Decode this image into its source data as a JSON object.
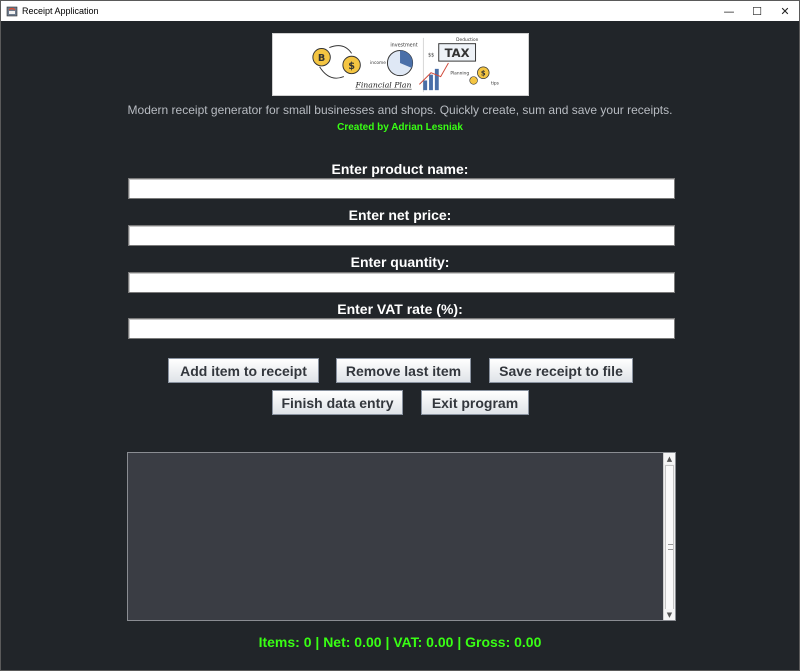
{
  "window": {
    "title": "Receipt Application",
    "controls": {
      "minimize": "—",
      "maximize": "☐",
      "close": "✕"
    }
  },
  "header": {
    "banner_icons": [
      "bitcoin-coin-icon",
      "dollar-coin-icon",
      "pie-chart-icon",
      "tax-board-icon",
      "bar-chart-icon"
    ],
    "banner_words": {
      "financial_plan": "Financial Plan",
      "investment": "investment",
      "income": "income",
      "tax": "TAX",
      "deduction": "Deduction",
      "planning": "Planning",
      "tips": "tips"
    },
    "tagline": "Modern receipt generator for small businesses and shops. Quickly create, sum and save your receipts.",
    "author": "Created by Adrian Lesniak"
  },
  "form": {
    "product_label": "Enter product name:",
    "product_value": "",
    "net_price_label": "Enter net price:",
    "net_price_value": "",
    "quantity_label": "Enter quantity:",
    "quantity_value": "",
    "vat_label": "Enter VAT rate (%):",
    "vat_value": ""
  },
  "buttons": {
    "add": "Add item to receipt",
    "remove": "Remove last item",
    "save": "Save receipt to file",
    "finish": "Finish data entry",
    "exit": "Exit program"
  },
  "receipt": {
    "content": ""
  },
  "summary": {
    "text": "Items: 0 | Net: 0.00 | VAT: 0.00 | Gross: 0.00"
  },
  "colors": {
    "background": "#212529",
    "accent_green": "#39ff14",
    "tagline_text": "#b8bcc2",
    "receipt_area": "#3a3d44"
  }
}
